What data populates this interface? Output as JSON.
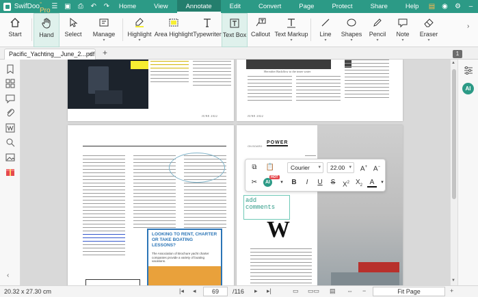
{
  "app": {
    "name": "SwifDoo",
    "suffix": "-Pro",
    "name_full": "SwifDoo-Pro"
  },
  "menu": {
    "items": [
      {
        "label": "Home"
      },
      {
        "label": "View"
      },
      {
        "label": "Annotate"
      },
      {
        "label": "Edit"
      },
      {
        "label": "Convert"
      },
      {
        "label": "Page"
      },
      {
        "label": "Protect"
      },
      {
        "label": "Share"
      },
      {
        "label": "Help"
      }
    ],
    "active": "Annotate"
  },
  "toolbar": {
    "start": "Start",
    "hand": "Hand",
    "select": "Select",
    "manage": "Manage",
    "highlight": "Highlight",
    "area_highlight": "Area Highlight",
    "typewriter": "Typewriter",
    "text_box": "Text Box",
    "callout": "Callout",
    "text_markup": "Text Markup",
    "line": "Line",
    "shapes": "Shapes",
    "pencil": "Pencil",
    "note": "Note",
    "eraser": "Eraser"
  },
  "tab": {
    "title": "Pacific_Yachting__June_2...pdf",
    "close": "×",
    "add": "+",
    "page_badge": "1"
  },
  "document": {
    "footer_left": "JUNE 2022",
    "footer_right": "JUNE 2022",
    "section_tag": "POWER",
    "section_tag_prefix": "ON BOARD",
    "ad_title": "LOOKING TO RENT, CHARTER OR TAKE BOATING LESSONS?",
    "ad_body": "The Association of Brochure yacht charter companies provide a variety of boating vacations.",
    "logo_letter": "W",
    "caption_top": "Hereafter Backflow to the inner water"
  },
  "format_bar": {
    "font": "Courier",
    "size": "22.00",
    "hot_badge": "HOT",
    "ai_label": "AI"
  },
  "textbox": {
    "text": "add comments"
  },
  "rightbar": {
    "ai_label": "AI"
  },
  "status": {
    "dimensions": "20.32 x 27.30 cm",
    "current_page": "69",
    "total_pages": "/116",
    "zoom": "Fit Page"
  },
  "colors": {
    "brand": "#2c9a86",
    "active_tab": "#247e6d",
    "highlight": "#f6ee32",
    "hot": "#e5484d"
  }
}
